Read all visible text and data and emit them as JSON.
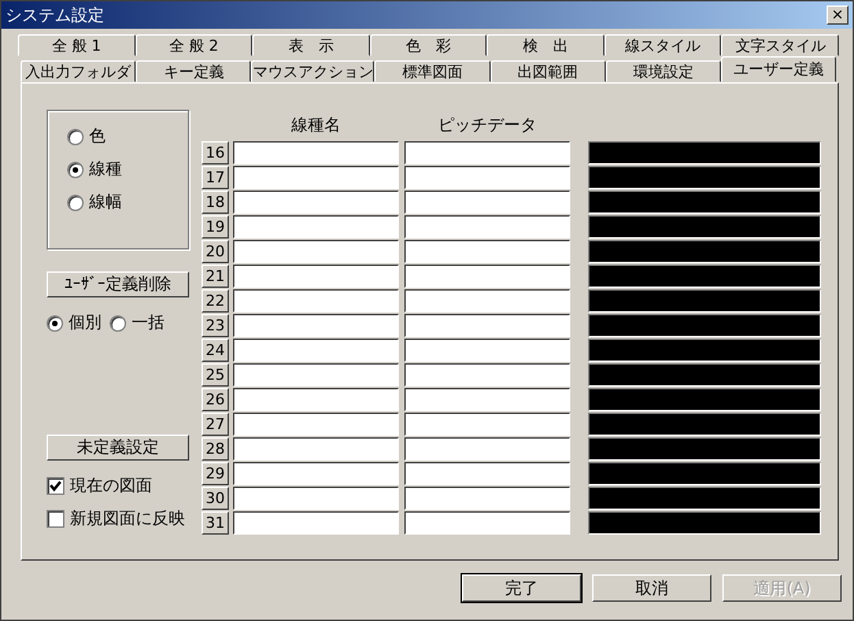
{
  "window": {
    "title": "システム設定",
    "close_label": "×"
  },
  "tab_rows": [
    [
      {
        "label": "全 般 1",
        "selected": false
      },
      {
        "label": "全 般 2",
        "selected": false
      },
      {
        "label": "表　示",
        "selected": false
      },
      {
        "label": "色　彩",
        "selected": false
      },
      {
        "label": "検　出",
        "selected": false
      },
      {
        "label": "線スタイル",
        "selected": false
      },
      {
        "label": "文字スタイル",
        "selected": false
      }
    ],
    [
      {
        "label": "入出力フォルダ",
        "selected": false
      },
      {
        "label": "キー定義",
        "selected": false
      },
      {
        "label": "マウスアクション",
        "selected": false
      },
      {
        "label": "標準図面",
        "selected": false
      },
      {
        "label": "出図範囲",
        "selected": false
      },
      {
        "label": "環境設定",
        "selected": false
      },
      {
        "label": "ユーザー定義",
        "selected": true
      }
    ]
  ],
  "mode_options": [
    {
      "label": "色",
      "selected": false
    },
    {
      "label": "線種",
      "selected": true
    },
    {
      "label": "線幅",
      "selected": false
    }
  ],
  "delete_button": "ﾕｰｻﾞｰ定義削除",
  "scope_options": [
    {
      "label": "個別",
      "selected": true
    },
    {
      "label": "一括",
      "selected": false
    }
  ],
  "undefined_button": "未定義設定",
  "checkboxes": [
    {
      "label": "現在の図面",
      "checked": true
    },
    {
      "label": "新規図面に反映",
      "checked": false
    }
  ],
  "columns": [
    "線種名",
    "ピッチデータ"
  ],
  "rows": [
    {
      "number": "16"
    },
    {
      "number": "17"
    },
    {
      "number": "18"
    },
    {
      "number": "19"
    },
    {
      "number": "20"
    },
    {
      "number": "21"
    },
    {
      "number": "22"
    },
    {
      "number": "23"
    },
    {
      "number": "24"
    },
    {
      "number": "25"
    },
    {
      "number": "26"
    },
    {
      "number": "27"
    },
    {
      "number": "28"
    },
    {
      "number": "29"
    },
    {
      "number": "30"
    },
    {
      "number": "31"
    }
  ],
  "buttons": [
    {
      "label": "完了",
      "disabled": false,
      "default": true
    },
    {
      "label": "取消",
      "disabled": false,
      "default": false
    },
    {
      "label": "適用(A)",
      "disabled": true,
      "default": false
    }
  ]
}
